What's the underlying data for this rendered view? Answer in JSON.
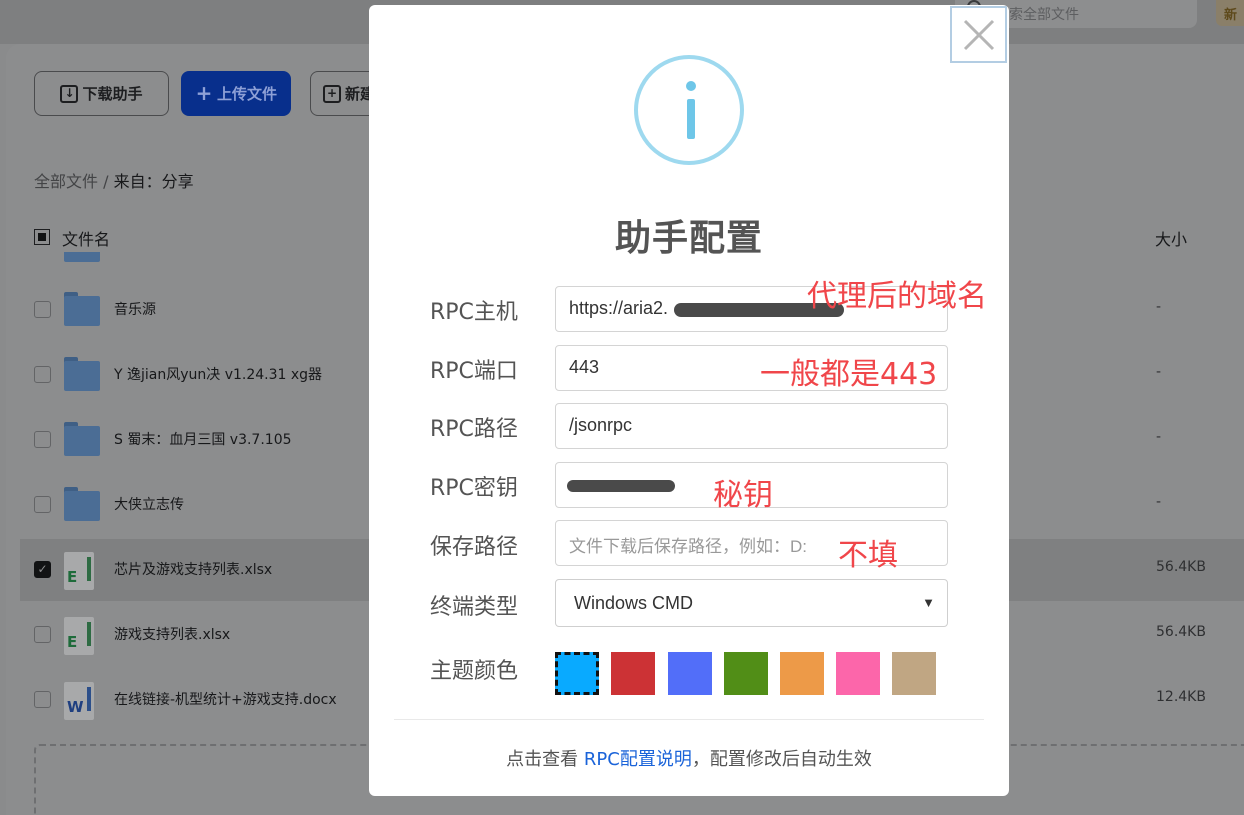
{
  "header": {
    "search_placeholder": "搜索全部文件",
    "new_label": "新"
  },
  "toolbar": {
    "download_helper": "下载助手",
    "upload": "上传文件",
    "new_folder": "新建"
  },
  "breadcrumb": {
    "root": "全部文件",
    "separator": "/",
    "current": "来自：分享"
  },
  "table": {
    "col_name": "文件名",
    "col_size": "大小",
    "rows": [
      {
        "name": "音乐源",
        "size": "-",
        "type": "folder",
        "checked": false
      },
      {
        "name": "Y 逸jian风yun决 v1.24.31 xg器",
        "size": "-",
        "type": "folder",
        "checked": false
      },
      {
        "name": "S 蜀末：血月三国 v3.7.105",
        "size": "-",
        "type": "folder",
        "checked": false
      },
      {
        "name": "大侠立志传",
        "size": "-",
        "type": "folder",
        "checked": false
      },
      {
        "name": "芯片及游戏支持列表.xlsx",
        "size": "56.4KB",
        "type": "xlsx",
        "checked": true
      },
      {
        "name": "游戏支持列表.xlsx",
        "size": "56.4KB",
        "type": "xlsx",
        "checked": false
      },
      {
        "name": "在线链接-机型统计+游戏支持.docx",
        "size": "12.4KB",
        "type": "docx",
        "checked": false
      }
    ]
  },
  "modal": {
    "title": "助手配置",
    "fields": {
      "rpc_host_label": "RPC主机",
      "rpc_host_value": "https://aria2.",
      "rpc_port_label": "RPC端口",
      "rpc_port_value": "443",
      "rpc_path_label": "RPC路径",
      "rpc_path_value": "/jsonrpc",
      "rpc_secret_label": "RPC密钥",
      "save_path_label": "保存路径",
      "save_path_placeholder": "文件下载后保存路径，例如：D:",
      "terminal_label": "终端类型",
      "terminal_value": "Windows CMD",
      "theme_label": "主题颜色"
    },
    "annotations": {
      "host": "代理后的域名",
      "port": "一般都是443",
      "secret": "秘钥",
      "save_path": "不填"
    },
    "theme_colors": [
      "#09aaff",
      "#cc3235",
      "#526ef9",
      "#518e17",
      "#ed9a48",
      "#fc66aa",
      "#c0a683"
    ],
    "footer": {
      "prefix": "点击查看 ",
      "link": "RPC配置说明",
      "suffix": "，配置修改后自动生效"
    },
    "icons": {
      "close": "close-icon",
      "info": "info-icon"
    }
  }
}
